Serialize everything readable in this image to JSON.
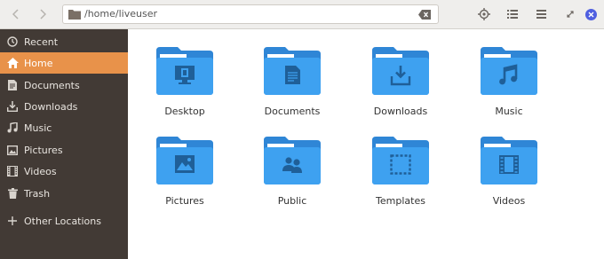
{
  "header": {
    "back_icon": "chevron-left-icon",
    "forward_icon": "chevron-right-icon",
    "path": "/home/liveuser",
    "tools": [
      "locate-icon",
      "view-list-icon",
      "menu-icon",
      "restore-icon",
      "close-icon"
    ]
  },
  "sidebar": {
    "items": [
      {
        "label": "Recent",
        "icon": "clock-icon"
      },
      {
        "label": "Home",
        "icon": "home-icon",
        "active": true
      },
      {
        "label": "Documents",
        "icon": "document-icon"
      },
      {
        "label": "Downloads",
        "icon": "download-icon"
      },
      {
        "label": "Music",
        "icon": "music-icon"
      },
      {
        "label": "Pictures",
        "icon": "picture-icon"
      },
      {
        "label": "Videos",
        "icon": "video-icon"
      },
      {
        "label": "Trash",
        "icon": "trash-icon"
      },
      {
        "label": "Other Locations",
        "icon": "plus-icon"
      }
    ]
  },
  "folders": [
    {
      "label": "Desktop",
      "icon": "desktop-icon"
    },
    {
      "label": "Documents",
      "icon": "document-icon"
    },
    {
      "label": "Downloads",
      "icon": "download-icon"
    },
    {
      "label": "Music",
      "icon": "music-icon"
    },
    {
      "label": "Pictures",
      "icon": "picture-icon"
    },
    {
      "label": "Public",
      "icon": "people-icon"
    },
    {
      "label": "Templates",
      "icon": "template-icon"
    },
    {
      "label": "Videos",
      "icon": "video-icon"
    }
  ],
  "colors": {
    "sidebar_bg": "#423a35",
    "active_bg": "#e8924a",
    "folder_blue": "#3ea1f0",
    "folder_dark": "#2f86d6",
    "glyph": "#1f5f98"
  }
}
